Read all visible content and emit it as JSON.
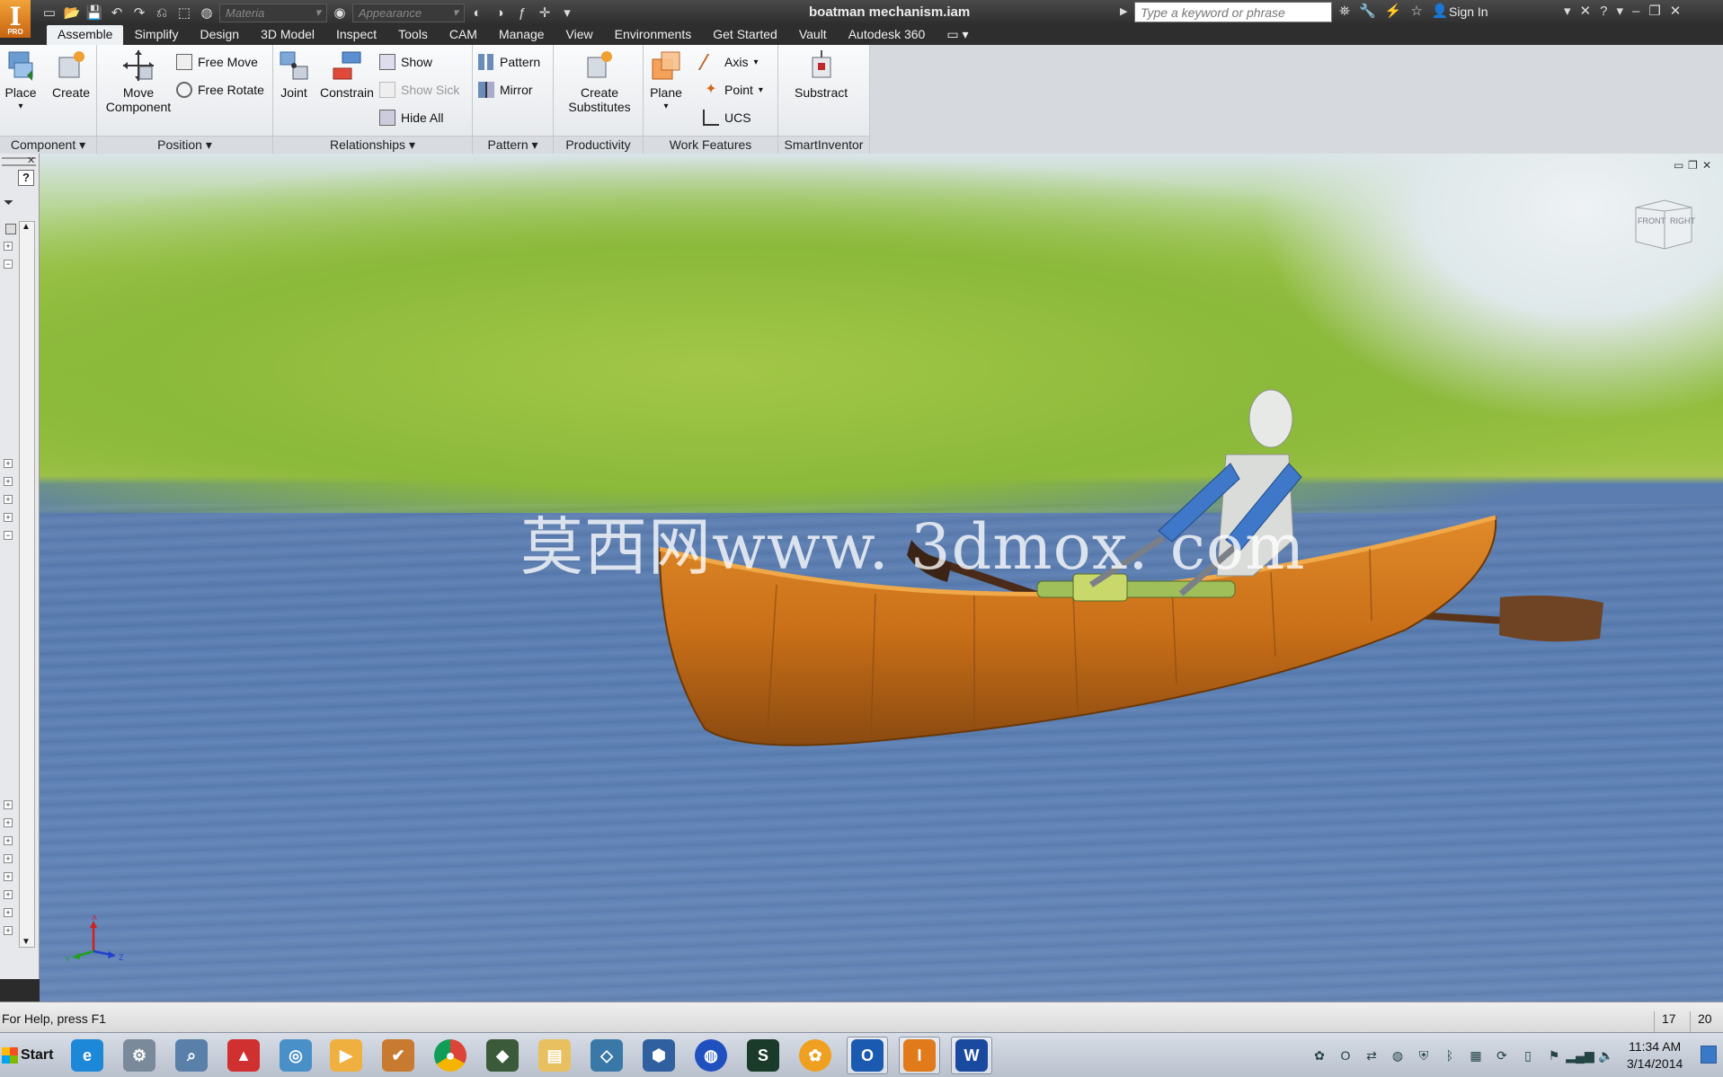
{
  "window": {
    "title": "boatman mechanism.iam",
    "material_placeholder": "Materia",
    "appearance_placeholder": "Appearance",
    "search_placeholder": "Type a keyword or phrase",
    "sign_in": "Sign In",
    "logo_text": "I",
    "logo_sub": "PRO"
  },
  "menu_tabs": [
    {
      "label": "Assemble",
      "active": true
    },
    {
      "label": "Simplify"
    },
    {
      "label": "Design"
    },
    {
      "label": "3D Model"
    },
    {
      "label": "Inspect"
    },
    {
      "label": "Tools"
    },
    {
      "label": "CAM"
    },
    {
      "label": "Manage"
    },
    {
      "label": "View"
    },
    {
      "label": "Environments"
    },
    {
      "label": "Get Started"
    },
    {
      "label": "Vault"
    },
    {
      "label": "Autodesk 360"
    }
  ],
  "ribbon": {
    "component": {
      "title": "Component",
      "place": "Place",
      "create": "Create"
    },
    "position": {
      "title": "Position",
      "move_component_1": "Move",
      "move_component_2": "Component",
      "free_move": "Free Move",
      "free_rotate": "Free Rotate"
    },
    "relationships": {
      "title": "Relationships",
      "joint": "Joint",
      "constrain": "Constrain",
      "show": "Show",
      "show_sick": "Show Sick",
      "hide_all": "Hide All"
    },
    "pattern": {
      "title": "Pattern",
      "pattern": "Pattern",
      "mirror": "Mirror"
    },
    "productivity": {
      "title": "Productivity",
      "create_substitutes_1": "Create",
      "create_substitutes_2": "Substitutes"
    },
    "work_features": {
      "title": "Work Features",
      "plane": "Plane",
      "axis": "Axis",
      "point": "Point",
      "ucs": "UCS"
    },
    "smartinventor": {
      "title": "SmartInventor",
      "substract": "Substract"
    }
  },
  "viewport": {
    "watermark": "莫西网www. 3dmox. com",
    "viewcube_front": "FRONT",
    "viewcube_right": "RIGHT",
    "axis_x": "X",
    "axis_y": "Y",
    "axis_z": "Z"
  },
  "status": {
    "help_text": "For Help, press F1",
    "num_a": "17",
    "num_b": "20"
  },
  "taskbar": {
    "start": "Start",
    "time": "11:34 AM",
    "date": "3/14/2014"
  }
}
